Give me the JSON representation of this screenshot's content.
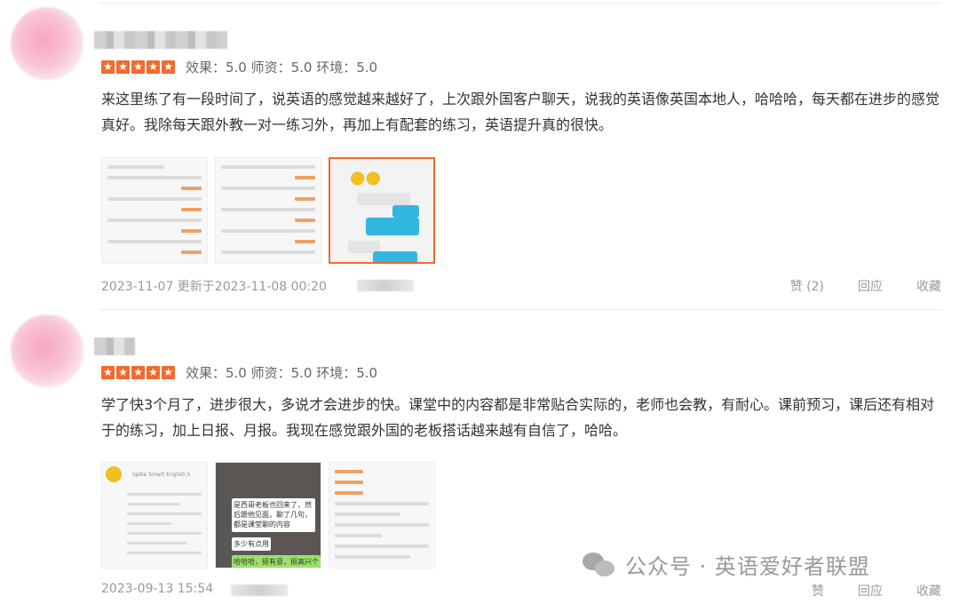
{
  "reviews": [
    {
      "scores": "效果：5.0  师资：5.0  环境：5.0",
      "content": "来这里练了有一段时间了，说英语的感觉越来越好了，上次跟外国客户聊天，说我的英语像英国本地人，哈哈哈，每天都在进步的感觉真好。我除每天跟外教一对一练习外，再加上有配套的练习，英语提升真的很快。",
      "date": "2023-11-07  更新于2023-11-08 00:20",
      "like_label": "赞 (2)",
      "reply_label": "回应",
      "collect_label": "收藏"
    },
    {
      "scores": "效果：5.0  师资：5.0  环境：5.0",
      "content": "学了快3个月了，进步很大，多说才会进步的快。课堂中的内容都是非常贴合实际的，老师也会教，有耐心。课前预习，课后还有相对于的练习，加上日报、月报。我现在感觉跟外国的老板搭话越来越有自信了，哈哈。",
      "date": "2023-09-13 15:54",
      "like_label": "赞",
      "reply_label": "回应",
      "collect_label": "收藏"
    }
  ],
  "thumb_texts": {
    "r2_t1_title": "Spike Smart English 5",
    "r2_t2_line1": "是西哥老板也回来了，然后跟他见面，聊了几句，都是课堂聊的内容",
    "r2_t2_line2": "多少有点用",
    "r2_t2_line3": "哈哈哈，挺有意，挺高兴个"
  },
  "watermark": "公众号 · 英语爱好者联盟",
  "colors": {
    "accent": "#f26a2e",
    "text": "#333333",
    "muted": "#999999"
  }
}
